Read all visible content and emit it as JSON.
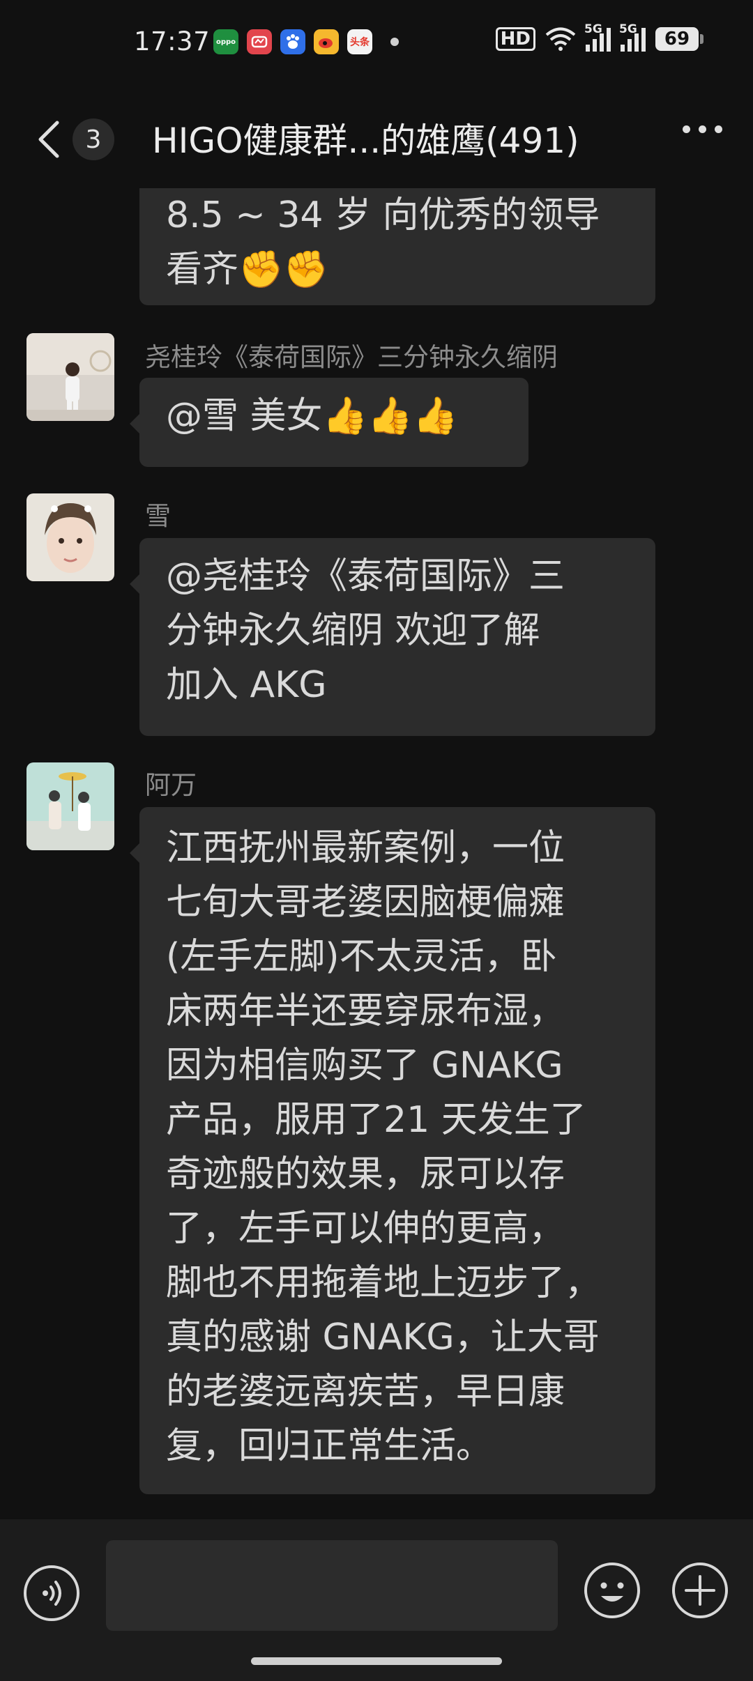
{
  "status_bar": {
    "time": "17:37",
    "app_icons": [
      "oppo-icon",
      "photo-app-icon",
      "baidu-icon",
      "weibo-icon",
      "toutiao-icon"
    ],
    "app_icon_labels": [
      "oppo",
      "",
      "",
      "",
      "头条"
    ],
    "hd_label": "HD",
    "network_1": "5G",
    "network_2": "5G",
    "battery": "69"
  },
  "header": {
    "unread_count": "3",
    "title": "HIGO健康群...的雄鹰(491)"
  },
  "messages": [
    {
      "sender": "",
      "lines": [
        "8.5 ~ 34 岁  向优秀的领导",
        "看齐✊✊"
      ]
    },
    {
      "sender": "尧桂玲《泰荷国际》三分钟永久缩阴",
      "lines": [
        "@雪  美女👍👍👍"
      ]
    },
    {
      "sender": "雪",
      "lines": [
        "@尧桂玲《泰荷国际》三",
        "分钟永久缩阴  欢迎了解",
        "加入 AKG"
      ]
    },
    {
      "sender": "阿万",
      "lines": [
        "江西抚州最新案例，一位",
        "七旬大哥老婆因脑梗偏瘫",
        "(左手左脚)不太灵活，卧",
        "床两年半还要穿尿布湿，",
        "因为相信购买了 GNAKG",
        "产品，服用了21 天发生了",
        "奇迹般的效果，尿可以存",
        "了，左手可以伸的更高，",
        "脚也不用拖着地上迈步了，",
        "真的感谢 GNAKG，让大哥",
        "的老婆远离疾苦，早日康",
        "复，回归正常生活。"
      ]
    }
  ],
  "input": {
    "value": "",
    "placeholder": ""
  },
  "colors": {
    "background": "#111111",
    "bubble": "#2c2c2c",
    "sender_name": "#8c8c8c",
    "input_bar": "#1c1c1c"
  }
}
